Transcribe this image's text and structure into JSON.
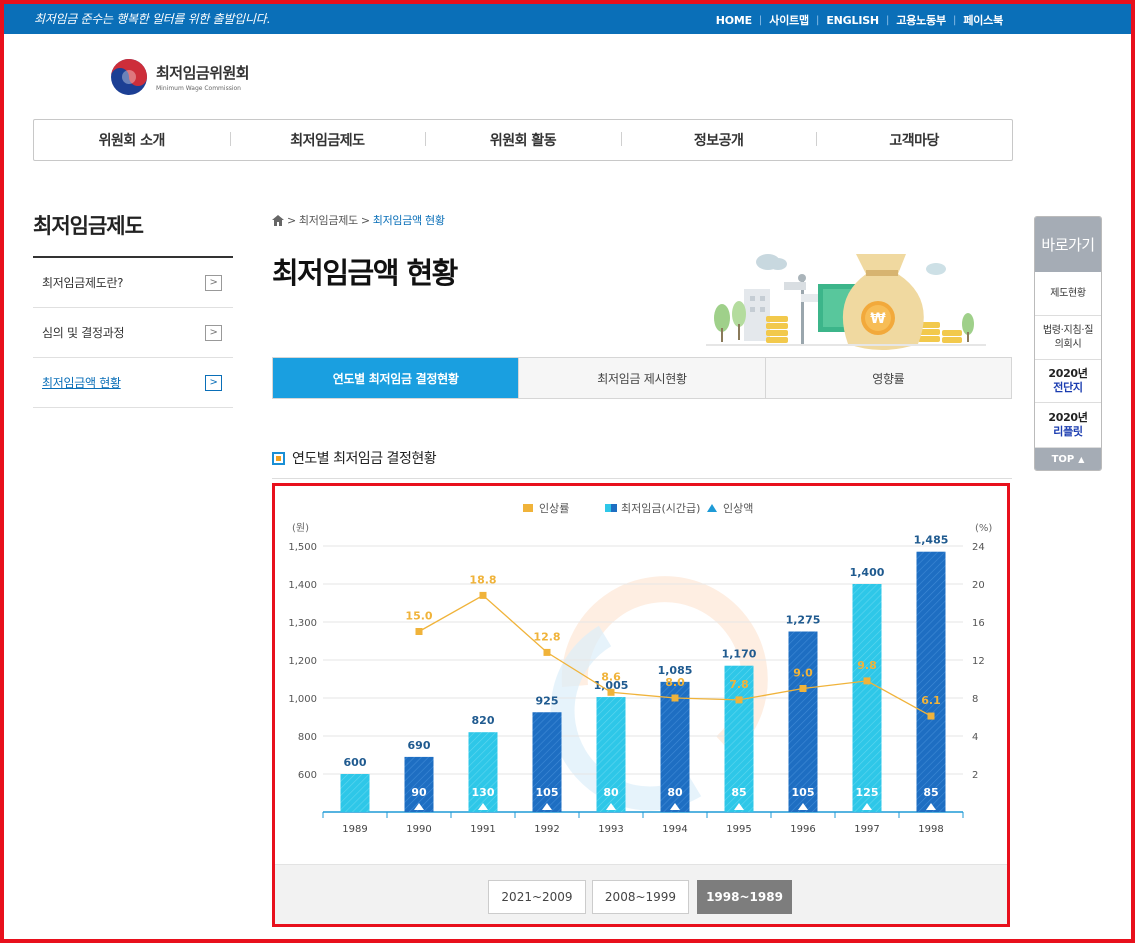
{
  "topbar": {
    "slogan": "최저임금 준수는 행복한 일터를 위한 출발입니다.",
    "links": [
      "HOME",
      "사이트맵",
      "ENGLISH",
      "고용노동부",
      "페이스북"
    ]
  },
  "logo": {
    "name_ko": "최저임금위원회",
    "name_en": "Minimum Wage Commission"
  },
  "gnb": [
    "위원회 소개",
    "최저임금제도",
    "위원회 활동",
    "정보공개",
    "고객마당"
  ],
  "lnb": {
    "title": "최저임금제도",
    "items": [
      {
        "label": "최저임금제도란?"
      },
      {
        "label": "심의 및 결정과정"
      },
      {
        "label": "최저임금액 현황"
      }
    ],
    "active_index": 2
  },
  "breadcrumb": {
    "items": [
      "최저임금제도",
      "최저임금액 현황"
    ]
  },
  "page_title": "최저임금액 현황",
  "tabs": [
    "연도별 최저임금 결정현황",
    "최저임금 제시현황",
    "영향률"
  ],
  "section_title": "연도별 최저임금 결정현황",
  "chart_data": {
    "type": "bar",
    "legend": [
      "인상률",
      "최저임금(시간급)",
      "인상액"
    ],
    "left_axis_label": "(원)",
    "right_axis_label": "(%)",
    "categories": [
      "1989",
      "1990",
      "1991",
      "1992",
      "1993",
      "1994",
      "1995",
      "1996",
      "1997",
      "1998"
    ],
    "series": [
      {
        "name": "최저임금(시간급)",
        "values": [
          600,
          690,
          820,
          925,
          1005,
          1085,
          1170,
          1275,
          1400,
          1485
        ],
        "labels": [
          "600",
          "690",
          "820",
          "925",
          "1,005",
          "1,085",
          "1,170",
          "1,275",
          "1,400",
          "1,485"
        ]
      },
      {
        "name": "인상액",
        "values": [
          null,
          90,
          130,
          105,
          80,
          80,
          85,
          105,
          125,
          85
        ]
      },
      {
        "name": "인상률",
        "values": [
          null,
          15.0,
          18.8,
          12.8,
          8.6,
          8.0,
          7.8,
          9.0,
          9.8,
          6.1
        ],
        "labels": [
          "",
          "15.0",
          "18.8",
          "12.8",
          "8.6",
          "8.0",
          "7.8",
          "9.0",
          "9.8",
          "6.1"
        ]
      }
    ],
    "left_ticks": [
      "600",
      "800",
      "1,000",
      "1,200",
      "1,300",
      "1,400",
      "1,500"
    ],
    "right_ticks": [
      "2",
      "4",
      "8",
      "12",
      "16",
      "20",
      "24"
    ],
    "colors": {
      "light_bar": "#2ec7e8",
      "dark_bar": "#1e6ec2",
      "rate": "#f0b33a",
      "amount_marker": "#ffffff"
    }
  },
  "period_buttons": [
    "2021~2009",
    "2008~1999",
    "1998~1989"
  ],
  "period_active": 2,
  "quick_menu": {
    "title": "바로가기",
    "items": [
      {
        "text": "제도현황"
      },
      {
        "text": "법령·지침·질의회시"
      },
      {
        "year": "2020년",
        "name": "전단지"
      },
      {
        "year": "2020년",
        "name": "리플릿"
      }
    ],
    "top_label": "TOP"
  }
}
